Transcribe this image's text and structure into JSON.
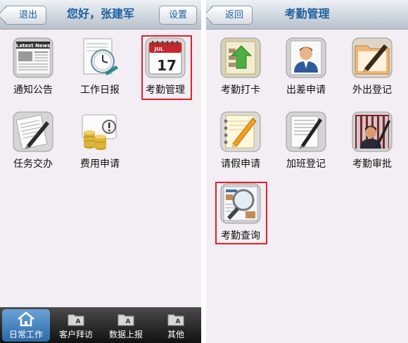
{
  "left_screen": {
    "header": {
      "back_label": "退出",
      "title": "您好，张建军",
      "settings_label": "设置"
    },
    "apps": [
      {
        "label": "通知公告"
      },
      {
        "label": "工作日报"
      },
      {
        "label": "考勤管理"
      },
      {
        "label": "任务交办"
      },
      {
        "label": "费用申请"
      }
    ],
    "icon_text": {
      "news_header": "Latest News",
      "calendar_month": "JUL",
      "calendar_day": "17"
    },
    "tabs": [
      {
        "label": "日常工作",
        "icon": "home-icon"
      },
      {
        "label": "客户拜访",
        "icon": "folder-a-icon"
      },
      {
        "label": "数据上报",
        "icon": "folder-a-icon"
      },
      {
        "label": "其他",
        "icon": "folder-a-icon"
      }
    ],
    "active_tab": "日常工作"
  },
  "right_screen": {
    "header": {
      "back_label": "返回",
      "title": "考勤管理"
    },
    "apps": [
      {
        "label": "考勤打卡"
      },
      {
        "label": "出差申请"
      },
      {
        "label": "外出登记"
      },
      {
        "label": "请假申请"
      },
      {
        "label": "加班登记"
      },
      {
        "label": "考勤审批"
      },
      {
        "label": "考勤查询"
      }
    ]
  },
  "colors": {
    "highlight": "#e3202a",
    "header_text": "#1f5f9e",
    "tab_active": "#3f7fbf"
  }
}
